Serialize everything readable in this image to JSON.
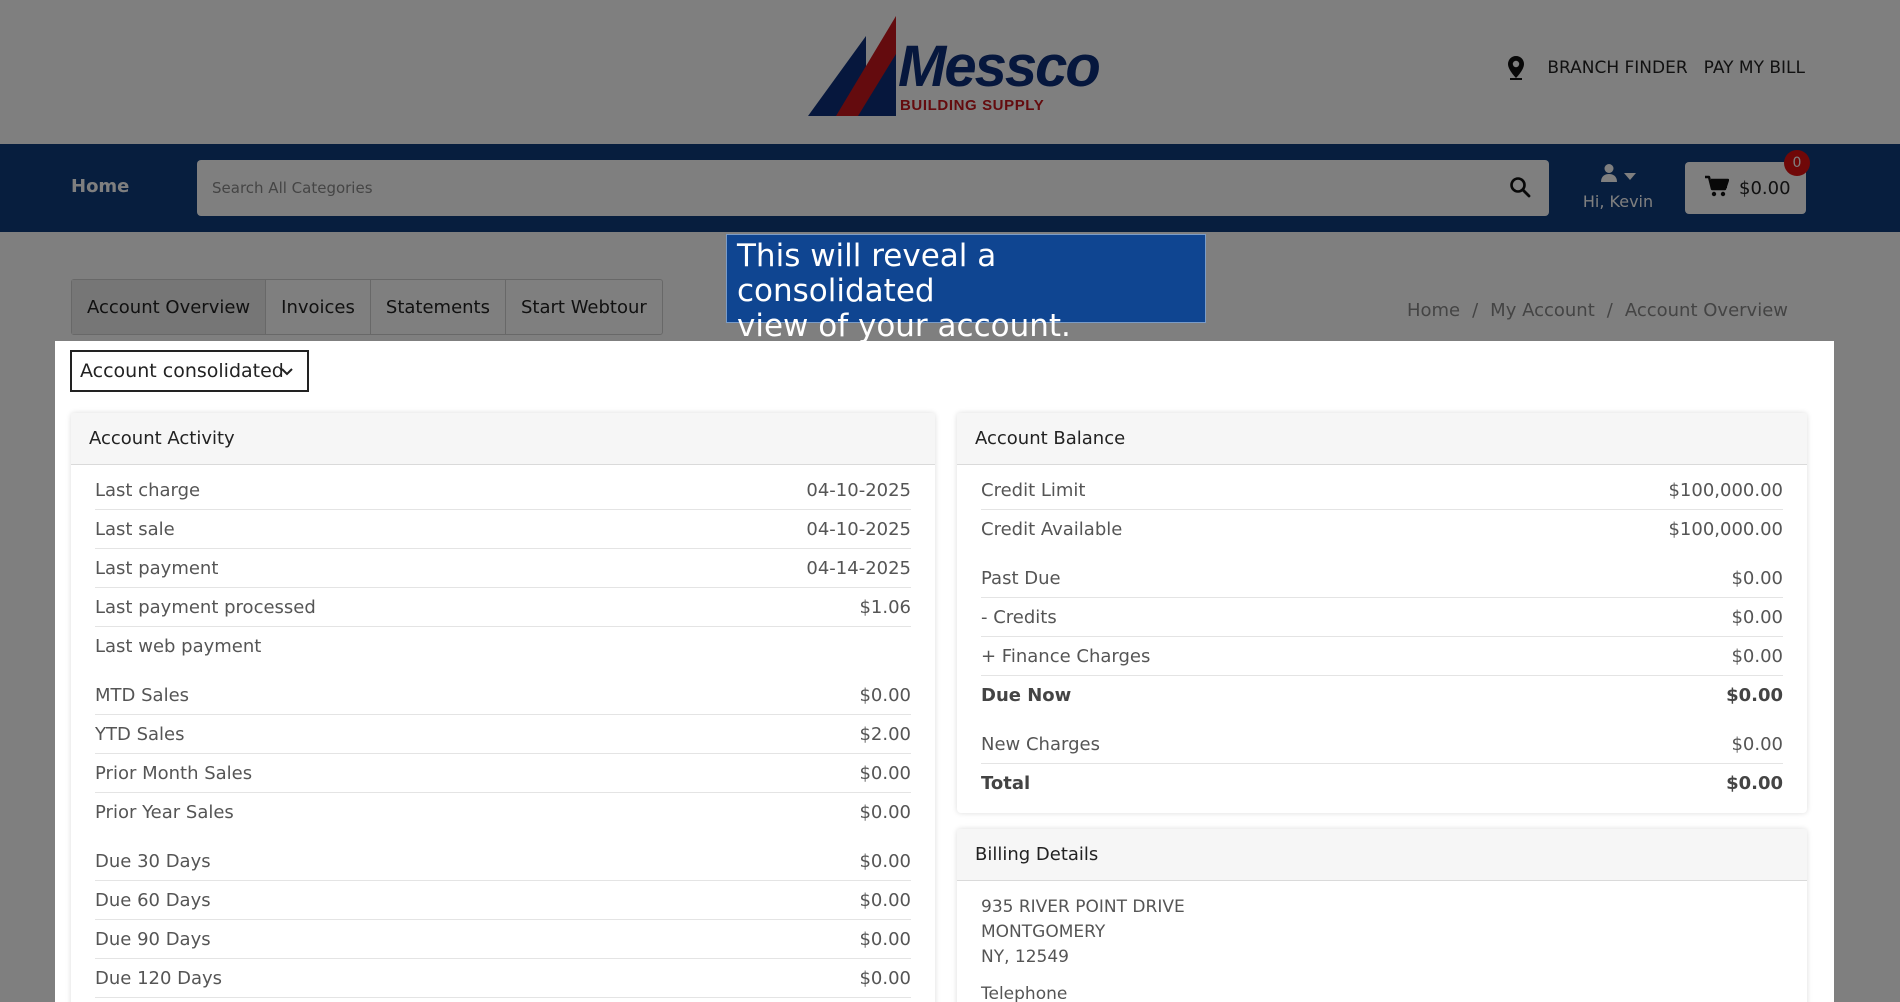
{
  "brand": {
    "name": "Messco",
    "tagline": "BUILDING SUPPLY",
    "colors": {
      "navy": "#0f3d7c",
      "brand_red": "#c8161d",
      "logo_blue": "#0d2f7a"
    }
  },
  "top_links": {
    "branch_finder": "BRANCH FINDER",
    "pay_my_bill": "PAY MY BILL",
    "icon": "map-pin-icon"
  },
  "nav": {
    "home": "Home",
    "search_placeholder": "Search All Categories",
    "user_greeting": "Hi, Kevin",
    "cart_total": "$0.00",
    "cart_count": "0"
  },
  "tabs": [
    {
      "label": "Account Overview",
      "active": true
    },
    {
      "label": "Invoices",
      "active": false
    },
    {
      "label": "Statements",
      "active": false
    },
    {
      "label": "Start Webtour",
      "active": false
    }
  ],
  "breadcrumb": [
    "Home",
    "My Account",
    "Account Overview"
  ],
  "tooltip": {
    "line1": "This will reveal a consolidated",
    "line2": "view of your account."
  },
  "account_select": {
    "value": "Account consolidated"
  },
  "activity": {
    "title": "Account Activity",
    "rows": [
      {
        "label": "Last charge",
        "value": "04-10-2025"
      },
      {
        "label": "Last sale",
        "value": "04-10-2025"
      },
      {
        "label": "Last payment",
        "value": "04-14-2025"
      },
      {
        "label": "Last payment processed",
        "value": "$1.06"
      },
      {
        "label": "Last web payment",
        "value": ""
      },
      {
        "label": "MTD Sales",
        "value": "$0.00"
      },
      {
        "label": "YTD Sales",
        "value": "$2.00"
      },
      {
        "label": "Prior Month Sales",
        "value": "$0.00"
      },
      {
        "label": "Prior Year Sales",
        "value": "$0.00"
      },
      {
        "label": "Due 30 Days",
        "value": "$0.00"
      },
      {
        "label": "Due 60 Days",
        "value": "$0.00"
      },
      {
        "label": "Due 90 Days",
        "value": "$0.00"
      },
      {
        "label": "Due 120 Days",
        "value": "$0.00"
      }
    ]
  },
  "balance": {
    "title": "Account Balance",
    "rows": [
      {
        "label": "Credit Limit",
        "value": "$100,000.00"
      },
      {
        "label": "Credit Available",
        "value": "$100,000.00"
      },
      {
        "label": "Past Due",
        "value": "$0.00"
      },
      {
        "label": "- Credits",
        "value": "$0.00"
      },
      {
        "label": "+ Finance Charges",
        "value": "$0.00"
      },
      {
        "label": "Due Now",
        "value": "$0.00"
      },
      {
        "label": "New Charges",
        "value": "$0.00"
      },
      {
        "label": "Total",
        "value": "$0.00"
      }
    ]
  },
  "billing": {
    "title": "Billing Details",
    "address_line1": "935 RIVER POINT DRIVE",
    "address_line2": "MONTGOMERY",
    "address_line3": "NY, 12549",
    "telephone_label": "Telephone"
  }
}
